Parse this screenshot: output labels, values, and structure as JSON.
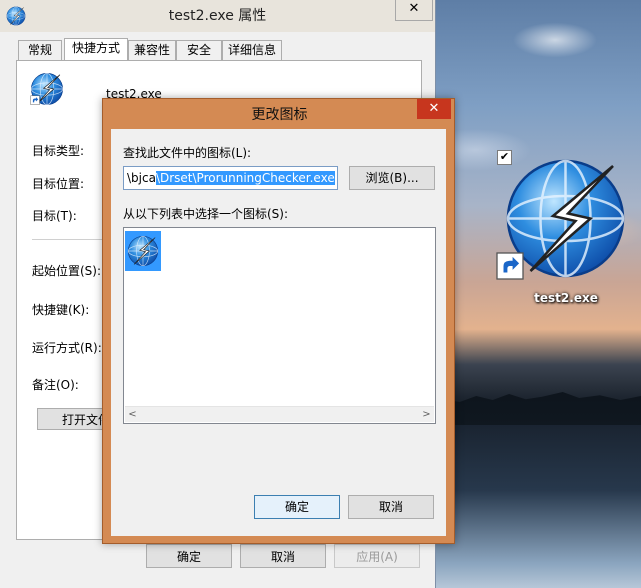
{
  "properties_window": {
    "title": "test2.exe 属性",
    "close_glyph": "✕",
    "tabs": [
      {
        "label": "常规"
      },
      {
        "label": "快捷方式"
      },
      {
        "label": "兼容性"
      },
      {
        "label": "安全"
      },
      {
        "label": "详细信息"
      }
    ],
    "active_tab": "快捷方式",
    "filename": "test2.exe",
    "fields": {
      "target_type": "目标类型:",
      "target_location": "目标位置:",
      "target": "目标(T):",
      "start_in": "起始位置(S):",
      "shortcut_key": "快捷键(K):",
      "run": "运行方式(R):",
      "comment": "备注(O):"
    },
    "open_file_location_label": "打开文件",
    "buttons": {
      "ok": "确定",
      "cancel": "取消",
      "apply": "应用(A)"
    }
  },
  "change_icon_dialog": {
    "title": "更改图标",
    "close_glyph": "✕",
    "find_label": "查找此文件中的图标(L):",
    "path_prefix": "\\bjca",
    "path_selected": "\\Drset\\ProrunningChecker.exe",
    "browse_label": "浏览(B)...",
    "list_label": "从以下列表中选择一个图标(S):",
    "icons": [
      {
        "name": "lightning-globe-icon",
        "selected": true
      }
    ],
    "scroll_left": "<",
    "scroll_right": ">",
    "ok_label": "确定",
    "cancel_label": "取消"
  },
  "desktop": {
    "icon_label": "test2.exe",
    "check_glyph": "✔",
    "icon_name": "lightning-globe-icon"
  },
  "colors": {
    "dialog_frame": "#d48a53",
    "close_red": "#c7361e",
    "selection_blue": "#3399ff"
  }
}
